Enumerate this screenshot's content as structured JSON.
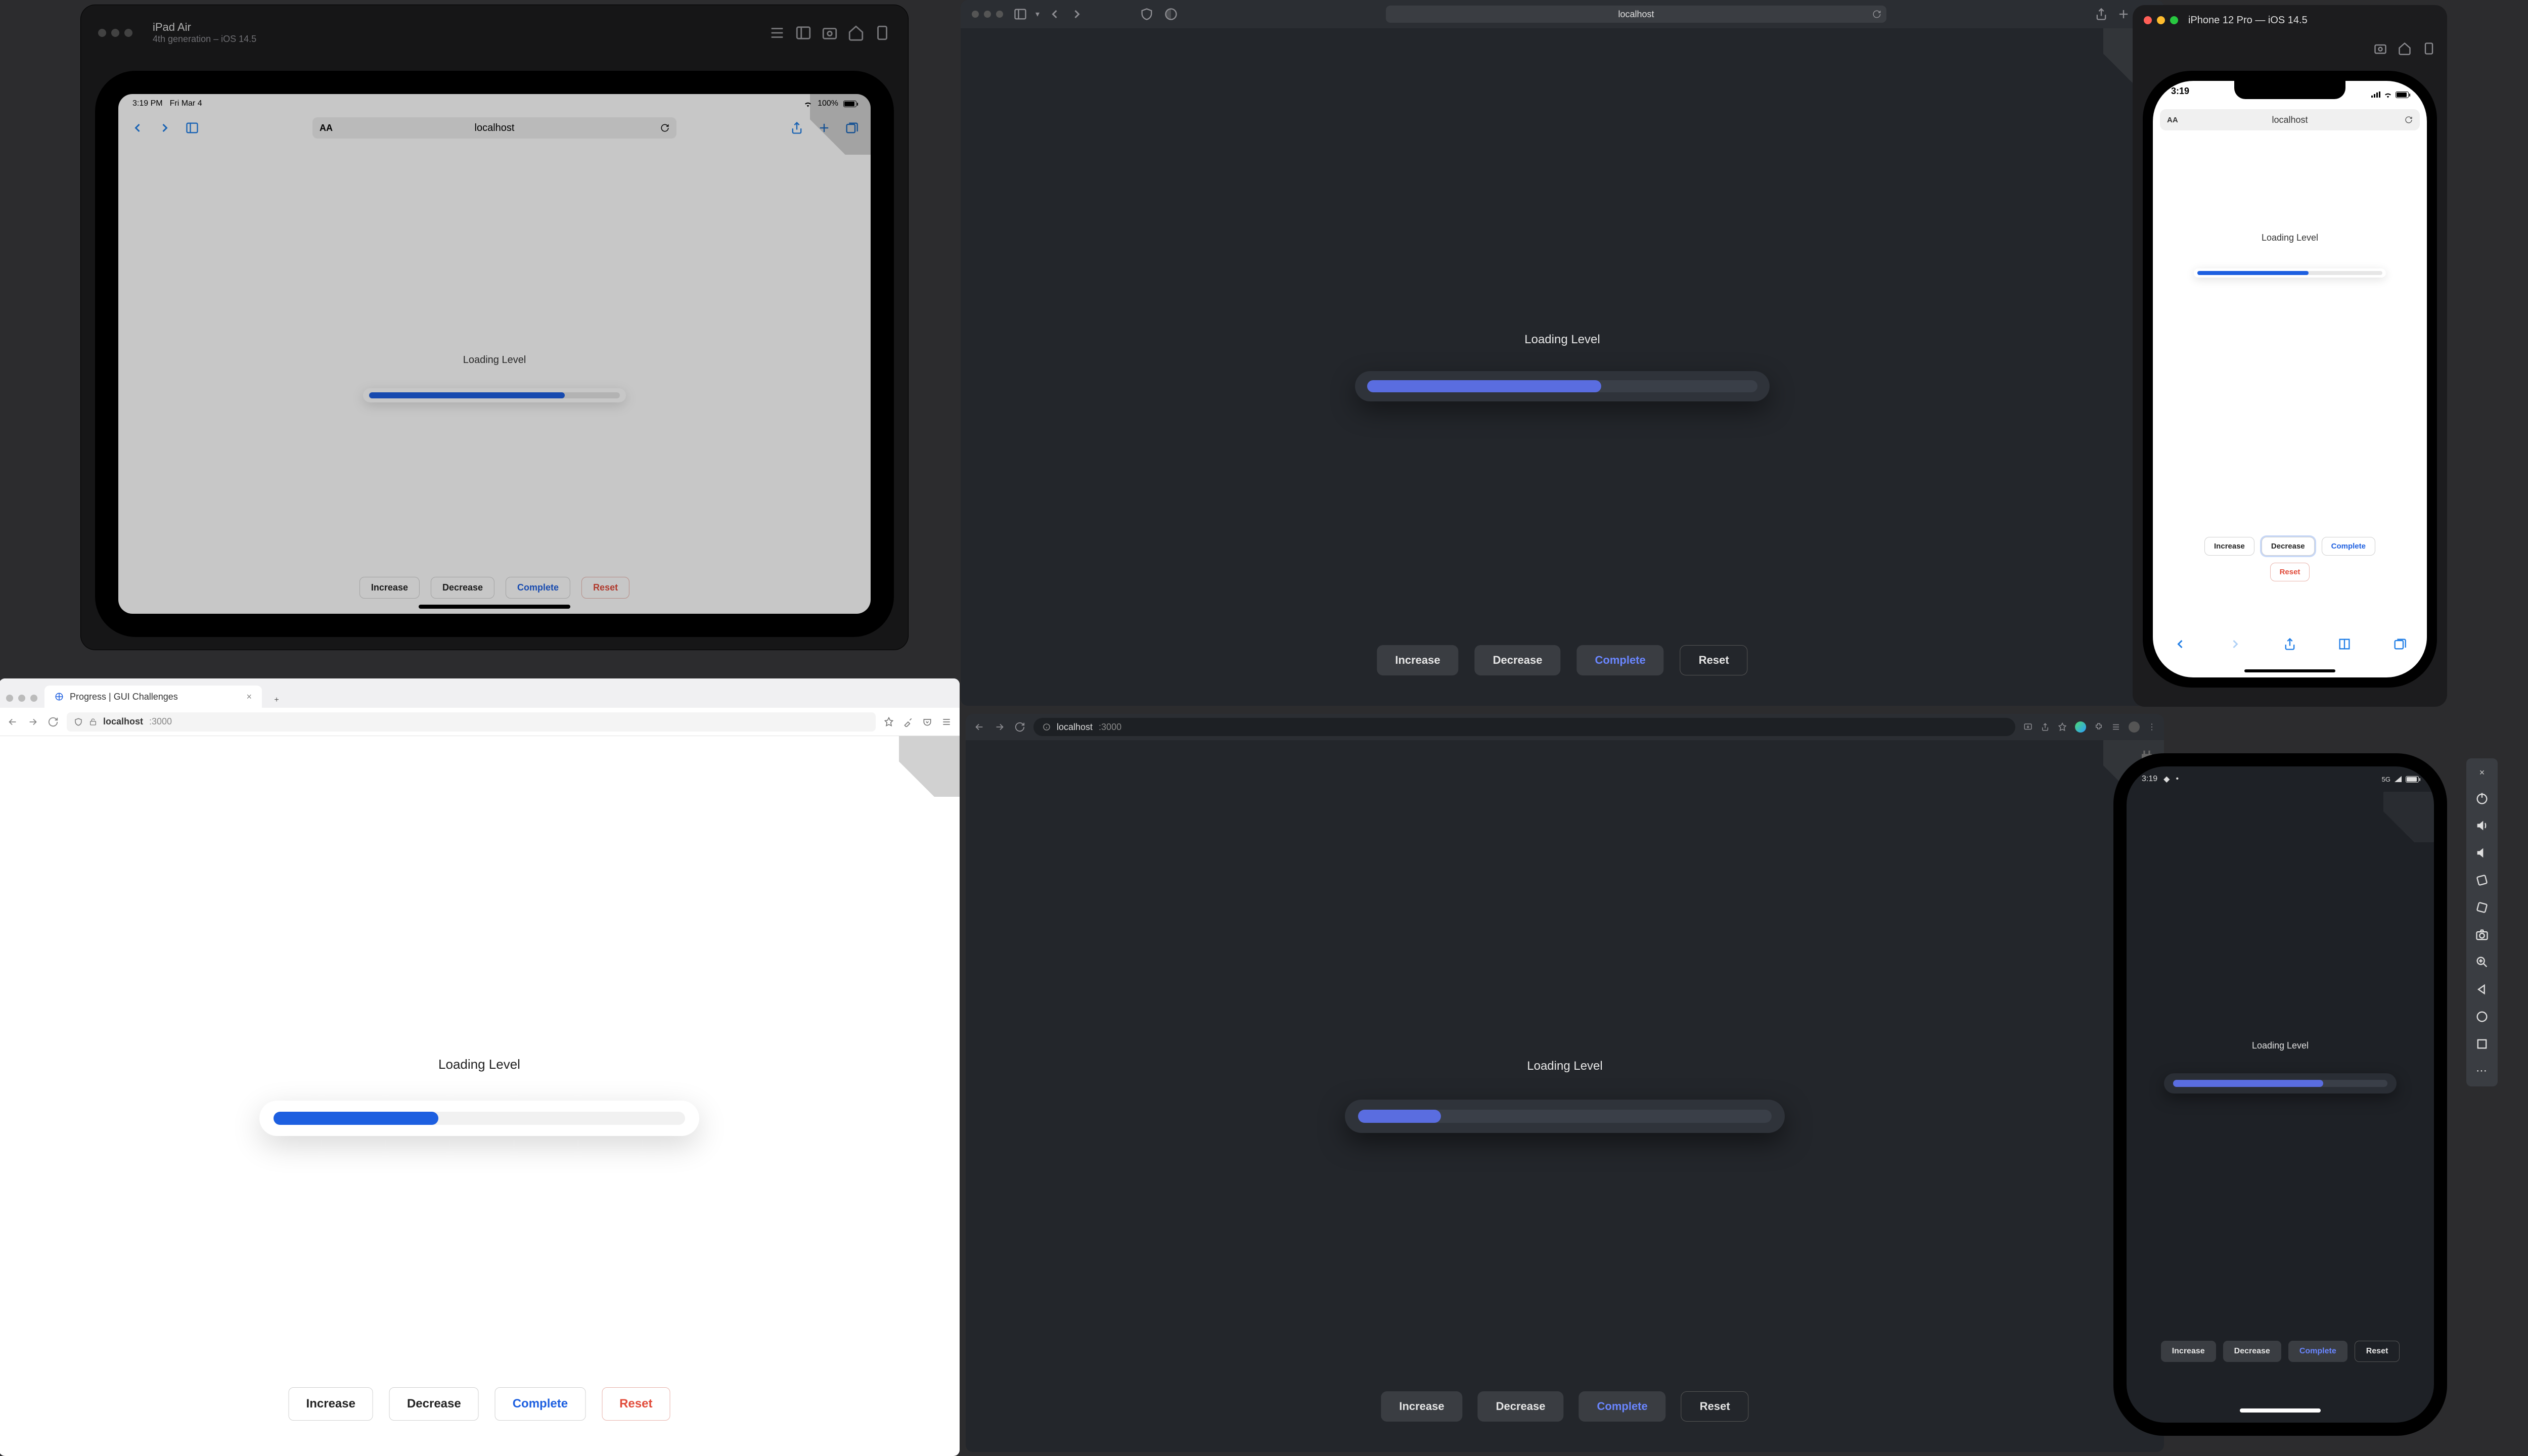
{
  "demo": {
    "heading": "Loading Level",
    "buttons": {
      "increase": "Increase",
      "decrease": "Decrease",
      "complete": "Complete",
      "reset": "Reset"
    }
  },
  "ipad_sim": {
    "title": "iPad Air",
    "subtitle": "4th generation – iOS 14.5",
    "status_time": "3:19 PM",
    "status_date": "Fri Mar 4",
    "battery": "100%",
    "url": "localhost",
    "progress_pct": 78
  },
  "safari": {
    "url": "localhost",
    "progress_pct": 60
  },
  "iphone_sim": {
    "title": "iPhone 12 Pro — iOS 14.5",
    "status_time": "3:19",
    "url": "localhost",
    "progress_pct": 60
  },
  "firefox": {
    "tab_title": "Progress | GUI Challenges",
    "url_host": "localhost",
    "url_port": ":3000",
    "progress_pct": 40
  },
  "chrome": {
    "url_host": "localhost",
    "url_port": ":3000",
    "progress_pct": 20
  },
  "android": {
    "status_time": "3:19",
    "status_net": "5G",
    "progress_pct": 70
  },
  "colors": {
    "accent_light": "#1d5fe0",
    "accent_dark": "#5a6de0",
    "danger": "#e14b3a"
  }
}
